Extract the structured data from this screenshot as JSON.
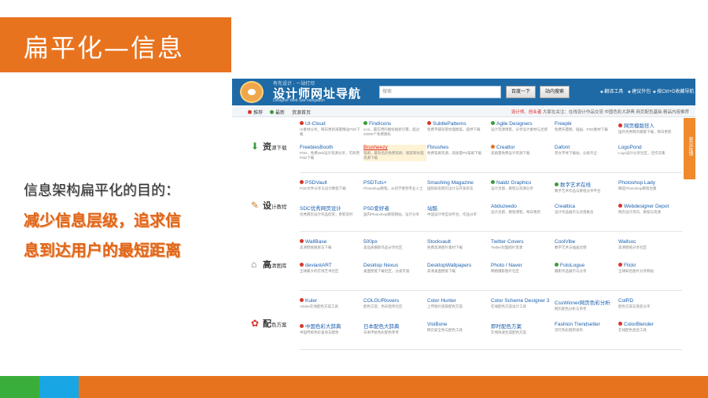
{
  "slide": {
    "title": "扁平化—信息",
    "intro": "信息架构扁平化的目的：",
    "emphasis_line1": "减少信息层级，追求信",
    "emphasis_line2": "息到达用户的最短距离"
  },
  "site": {
    "logo_small": "有先设计 · 一站打尽",
    "logo_title": "设计师网址导航",
    "logo_sub": "Designer Web Site navigation",
    "search_placeholder": "搜索",
    "btn_search": "百度一下",
    "btn_search_site": "站内搜索",
    "header_links": [
      "翻译工具",
      "建议外包",
      "按Ctrl+D收藏导航"
    ],
    "subbar_left": [
      "推荐",
      "最新",
      "资源首页"
    ],
    "subbar_notice_red": "设计师、创业者",
    "subbar_notice": "大家在关注：在线设计作品交流  中国色彩大辞典  网页配色基础  精品内容推荐",
    "side_tab": "意见反馈",
    "rows": [
      {
        "category_main": "资",
        "category_small": "源下载",
        "category_icon": "download-icon",
        "columns": [
          [
            {
              "title": "UI-Cloud",
              "dot": "red",
              "desc": "UI素材分享，每日更新海量精品PSD下载"
            },
            {
              "title": "FreebiesBooth",
              "dot": "",
              "desc": "PSD、免费web设计资源分享，可商用PSD下载"
            }
          ],
          [
            {
              "title": "FindIcons",
              "dot": "green",
              "desc": "icon，最实用的图标搜索引擎，超过40000个免费图标"
            },
            {
              "title": "Brusheezy",
              "dot": "",
              "desc": "笔刷，最有名的免费笔刷、图案和纹理资源下载",
              "highlight": true
            }
          ],
          [
            {
              "title": "SubtlePatterns",
              "dot": "red",
              "desc": "免费平铺背景纹理图案，提供下载"
            },
            {
              "title": "Fbrushes",
              "dot": "",
              "desc": "免费笔刷资源，高质量PS笔刷下载"
            }
          ],
          [
            {
              "title": "Agile Designers",
              "dot": "green",
              "desc": "设计资源博客，分享设计素材与灵感"
            },
            {
              "title": "Creattor",
              "dot": "orange",
              "desc": "高质量免费设计资源下载"
            }
          ],
          [
            {
              "title": "Freepik",
              "dot": "",
              "desc": "免费矢量图、插画、PSD素材下载"
            },
            {
              "title": "Dafont",
              "dot": "",
              "desc": "英文字体下载站，分类齐全"
            }
          ],
          [
            {
              "title": "网页模版狂人",
              "dot": "red",
              "desc": "国外优秀网页模版下载，每日更新"
            },
            {
              "title": "LogoPond",
              "dot": "",
              "desc": "Logo设计分享社区，佳作云集"
            }
          ]
        ]
      },
      {
        "category_main": "设",
        "category_small": "计教程",
        "category_icon": "tools-icon",
        "columns": [
          [
            {
              "title": "PSDVault",
              "dot": "red",
              "desc": "PSD文件分享与设计教程下载"
            },
            {
              "title": "SDC优秀网页设计",
              "dot": "",
              "desc": "优秀网页设计作品欣赏，更新及时"
            }
          ],
          [
            {
              "title": "PSDTuts+",
              "dot": "",
              "desc": "Photoshop教程，从初学者到专业人士"
            },
            {
              "title": "PSD爱好者",
              "dot": "",
              "desc": "国内Photoshop教程网站，设计分享"
            }
          ],
          [
            {
              "title": "Smashing Magazine",
              "dot": "",
              "desc": "国际知名网页设计与开发杂志"
            },
            {
              "title": "站酷",
              "dot": "",
              "desc": "中国设计师互动平台，作品分享"
            }
          ],
          [
            {
              "title": "Naldz Graphics",
              "dot": "green",
              "desc": "设计灵感、教程与资源分享"
            },
            {
              "title": "Abduzeedo",
              "dot": "",
              "desc": "设计灵感、教程博客，每日更新"
            }
          ],
          [
            {
              "title": "数字艺术在线",
              "dot": "green",
              "desc": "数字艺术作品与教程分享平台"
            },
            {
              "title": "Creattica",
              "dot": "",
              "desc": "设计作品展示与灵感集合"
            }
          ],
          [
            {
              "title": "Photoshop Lady",
              "dot": "",
              "desc": "精选Photoshop教程合集"
            },
            {
              "title": "Webdesigner Depot",
              "dot": "red",
              "desc": "网页设计资讯、教程与资源"
            }
          ]
        ]
      },
      {
        "category_main": "高",
        "category_small": "清图库",
        "category_icon": "home-icon",
        "columns": [
          [
            {
              "title": "WallBase",
              "dot": "red",
              "desc": "高清壁纸搜索与下载"
            },
            {
              "title": "deviantART",
              "dot": "red",
              "desc": "全球最大的在线艺术社区"
            }
          ],
          [
            {
              "title": "500px",
              "dot": "",
              "desc": "高品质摄影作品分享社区"
            },
            {
              "title": "Desktop Nexus",
              "dot": "",
              "desc": "桌面壁纸下载社区，分类丰富"
            }
          ],
          [
            {
              "title": "Stockvault",
              "dot": "",
              "desc": "免费高清图片素材下载"
            },
            {
              "title": "DesktopWallpapers",
              "dot": "",
              "desc": "高清桌面壁纸下载"
            }
          ],
          [
            {
              "title": "Twitter Covers",
              "dot": "",
              "desc": "Twitter封面图片资源"
            },
            {
              "title": "Photo / Naver",
              "dot": "",
              "desc": "网络摄影图片社区"
            }
          ],
          [
            {
              "title": "CoolVibe",
              "dot": "",
              "desc": "数字艺术与插画灵感"
            },
            {
              "title": "FotoLogue",
              "dot": "green",
              "desc": "摄影作品展示与分享"
            }
          ],
          [
            {
              "title": "Wallsoc",
              "dot": "",
              "desc": "高清壁纸分享社区"
            },
            {
              "title": "Flickr",
              "dot": "red",
              "desc": "全球知名图片分享网站"
            }
          ]
        ]
      },
      {
        "category_main": "配",
        "category_small": "色方案",
        "category_icon": "palette-icon",
        "columns": [
          [
            {
              "title": "Kuler",
              "dot": "red",
              "desc": "Adobe在线配色方案工具"
            },
            {
              "title": "中国色彩大辞典",
              "dot": "red",
              "desc": "中国传统色彩查询与配色"
            }
          ],
          [
            {
              "title": "COLOURlovers",
              "dot": "",
              "desc": "配色方案、色彩趋势社区"
            },
            {
              "title": "日本配色大辞典",
              "dot": "",
              "desc": "日本传统色彩配色参考"
            }
          ],
          [
            {
              "title": "Color Hunter",
              "dot": "",
              "desc": "上传图片提取配色方案"
            },
            {
              "title": "VisiBone",
              "dot": "",
              "desc": "网页安全色与配色工具"
            }
          ],
          [
            {
              "title": "Color Scheme Designer 3",
              "dot": "",
              "desc": "在线配色方案设计工具"
            },
            {
              "title": "即时配色方案",
              "dot": "",
              "desc": "在线快速生成配色方案"
            }
          ],
          [
            {
              "title": "CssWinner网页色彩分析",
              "dot": "",
              "desc": "网页配色分析与参考"
            },
            {
              "title": "Fashion Trendsetter",
              "dot": "",
              "desc": "流行色彩趋势发布"
            }
          ],
          [
            {
              "title": "ColRD",
              "dot": "",
              "desc": "配色方案与渐变分享"
            },
            {
              "title": "ColorBlender",
              "dot": "red",
              "desc": "在线配色混合工具"
            }
          ]
        ]
      }
    ]
  },
  "colors": {
    "accent_orange": "#e8731e",
    "site_header_blue": "#1e6aa6",
    "stripe_green": "#3aae3a",
    "stripe_blue": "#19a6e4"
  }
}
